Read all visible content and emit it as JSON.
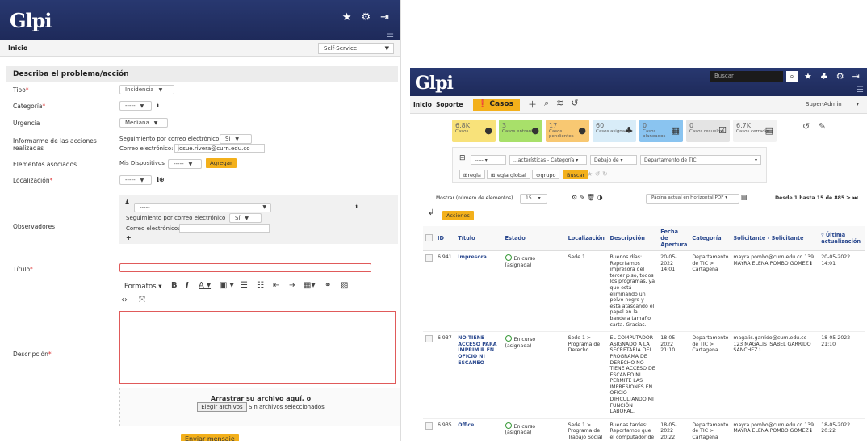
{
  "left": {
    "brand": "Glpi",
    "breadcrumb": "Inicio",
    "profile": "Self-Service",
    "form_title": "Describa el problema/acción",
    "labels": {
      "tipo": "Tipo",
      "categoria": "Categoría",
      "urgencia": "Urgencia",
      "informarme": "Informarme de las acciones realizadas",
      "elementos": "Elementos asociados",
      "localizacion": "Localización",
      "observadores": "Observadores",
      "titulo": "Título",
      "descripcion": "Descripción"
    },
    "values": {
      "tipo": "Incidencia",
      "categoria": "-----",
      "urgencia": "Mediana",
      "seguimiento_label": "Seguimiento por correo electrónico",
      "seguimiento_value": "Sí",
      "correo_label": "Correo electrónico:",
      "correo_value": "josue.rivera@curn.edu.co",
      "mis_dispositivos": "Mis Dispositivos",
      "dispositivo_sel": "-----",
      "agregar": "Agregar",
      "localizacion": "-----",
      "obs_user": "-----",
      "obs_seguimiento_label": "Seguimiento por correo electrónico",
      "obs_seguimiento_value": "Sí",
      "obs_correo_label": "Correo electrónico:",
      "obs_plus": "+",
      "formatos": "Formatos",
      "dropzone_title": "Arrastrar su archivo aquí, o",
      "file_button": "Elegir archivos",
      "file_status": "Sin archivos seleccionados",
      "submit": "Enviar mensaje"
    },
    "required_mark": "*"
  },
  "right": {
    "brand": "Glpi",
    "search_placeholder": "Buscar",
    "nav": {
      "inicio": "Inicio",
      "soporte": "Soporte",
      "casos": "Casos"
    },
    "profile": "Super-Admin",
    "tiles": [
      {
        "num": "6.8K",
        "label": "Casos",
        "color": "#f8e27a"
      },
      {
        "num": "3",
        "label": "Casos entrantes",
        "color": "#a8e06a"
      },
      {
        "num": "17",
        "label": "Casos pendientes",
        "color": "#f8c872"
      },
      {
        "num": "60",
        "label": "Casos asignados",
        "color": "#d8ecf8"
      },
      {
        "num": "0",
        "label": "Casos planeados",
        "color": "#8ac4f0"
      },
      {
        "num": "0",
        "label": "Casos resueltos",
        "color": "#e4e4e4"
      },
      {
        "num": "6.7K",
        "label": "Casos cerrados",
        "color": "#f2f2f2"
      }
    ],
    "filter": {
      "sel1": "-----",
      "sel2": "...acterísticas - Categoría",
      "sel3": "Debajo de",
      "sel4": "Departamento de TIC",
      "regla": "regla",
      "regla_global": "regla global",
      "grupo": "grupo",
      "buscar": "Buscar"
    },
    "list": {
      "mostrar": "Mostrar (número de elementos)",
      "per_page": "15",
      "export": "Página actual en Horizontal PDF",
      "range": "Desde 1 hasta 15 de 885",
      "acciones": "Acciones"
    },
    "columns": [
      "ID",
      "Título",
      "Estado",
      "Localización",
      "Descripción",
      "Fecha de Apertura",
      "Categoría",
      "Solicitante - Solicitante",
      "▿ Última actualización"
    ],
    "rows": [
      {
        "id": "6 941",
        "titulo": "Impresora",
        "estado": "En curso (asignada)",
        "localizacion": "Sede 1",
        "descripcion": "Buenos días: Reportamos impresora del tercer piso, todos los programas, ya que está eliminando un polvo negro y está atascando el papel en la bandeja tamaño carta. Gracias.",
        "fecha": "20-05-2022 14:01",
        "categoria": "Departamento de TIC > Cartagena",
        "solicitante": "mayra.pombo@curn.edu.co 139 MAYRA ELENA POMBO GOMEZ",
        "actualizacion": "20-05-2022 14:01"
      },
      {
        "id": "6 937",
        "titulo": "NO TIENE ACCESO PARA IMPRIMIR EN OFICIO NI ESCANEO",
        "estado": "En curso (asignada)",
        "localizacion": "Sede 1 > Programa de Derecho",
        "descripcion": "EL COMPUTADOR ASIGNADO A LA SECRETARIA DEL PROGRAMA DE DERECHO NO TIENE ACCESO DE ESCANEO NI PERMITE LAS IMPRESIONES EN OFICIO DIFICULTANDO MI FUNCIÓN LABORAL.",
        "fecha": "18-05-2022 21:10",
        "categoria": "Departamento de TIC > Cartagena",
        "solicitante": "magalis.garrido@curn.edu.co 123 MAGALIS ISABEL GARRIDO SANCHEZ",
        "actualizacion": "18-05-2022 21:10"
      },
      {
        "id": "6 935",
        "titulo": "Office",
        "estado": "En curso (asignada)",
        "localizacion": "Sede 1 > Programa de Trabajo Social",
        "descripcion": "Buenas tardes: Reportamos que el computador de la Directora de Programa de",
        "fecha": "18-05-2022 20:22",
        "categoria": "Departamento de TIC > Cartagena",
        "solicitante": "mayra.pombo@curn.edu.co 139 MAYRA ELENA POMBO GOMEZ",
        "actualizacion": "18-05-2022 20:22"
      }
    ]
  }
}
